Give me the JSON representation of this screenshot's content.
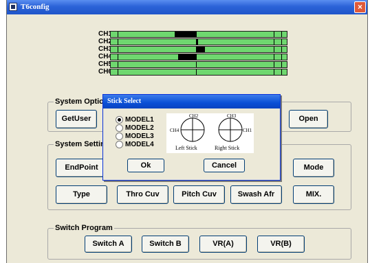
{
  "window": {
    "title": "T6config",
    "close_label": "×"
  },
  "channels": [
    {
      "label": "CH1",
      "block_from": 0.36,
      "block_to": 0.48
    },
    {
      "label": "CH2",
      "block_from": 0.48,
      "block_to": 0.49
    },
    {
      "label": "CH3",
      "block_from": 0.48,
      "block_to": 0.53
    },
    {
      "label": "CH4",
      "block_from": 0.38,
      "block_to": 0.48
    },
    {
      "label": "CH5",
      "block_from": 0.48,
      "block_to": 0.48
    },
    {
      "label": "CH6",
      "block_from": 0.48,
      "block_to": 0.48
    }
  ],
  "system_options": {
    "legend": "System Optio",
    "getuser": "GetUser",
    "open": "Open"
  },
  "system_settings": {
    "legend": "System Settin",
    "endpoint": "EndPoint",
    "mode": "Mode",
    "type": "Type",
    "thro_cuv": "Thro Cuv",
    "pitch_cuv": "Pitch Cuv",
    "swash_afr": "Swash Afr",
    "mix": "MIX."
  },
  "switch_program": {
    "legend": "Switch Program",
    "switch_a": "Switch A",
    "switch_b": "Switch B",
    "vra": "VR(A)",
    "vrb": "VR(B)"
  },
  "stick_dialog": {
    "title": "Stick Select",
    "models": [
      "MODEL1",
      "MODEL2",
      "MODEL3",
      "MODEL4"
    ],
    "selected": "MODEL1",
    "left_stick": {
      "label": "Left Stick",
      "top": "CH2",
      "side": "CH4"
    },
    "right_stick": {
      "label": "Right Stick",
      "top": "CH3",
      "side": "CH1"
    },
    "ok": "Ok",
    "cancel": "Cancel"
  }
}
